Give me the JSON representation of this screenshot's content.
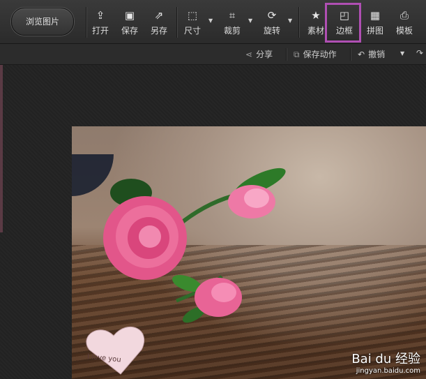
{
  "toolbar": {
    "browse_label": "浏览图片",
    "tools": [
      {
        "label": "打开",
        "icon": "open-icon",
        "glyph": "⇪"
      },
      {
        "label": "保存",
        "icon": "save-icon",
        "glyph": "▣"
      },
      {
        "label": "另存",
        "icon": "save-as-icon",
        "glyph": "⇗"
      },
      {
        "label": "尺寸",
        "icon": "resize-icon",
        "glyph": "⬚"
      },
      {
        "label": "裁剪",
        "icon": "crop-icon",
        "glyph": "⌗"
      },
      {
        "label": "旋转",
        "icon": "rotate-icon",
        "glyph": "⟳"
      },
      {
        "label": "素材",
        "icon": "sticker-icon",
        "glyph": "★"
      },
      {
        "label": "边框",
        "icon": "border-icon",
        "glyph": "◰"
      },
      {
        "label": "拼图",
        "icon": "collage-icon",
        "glyph": "▦"
      },
      {
        "label": "模板",
        "icon": "template-icon",
        "glyph": "⎙"
      }
    ]
  },
  "subbar": {
    "share_label": "分享",
    "save_action_label": "保存动作",
    "undo_label": "撤销"
  },
  "photo": {
    "heart_text": "I love you",
    "watermark_brand": "Bai du 经验",
    "watermark_url": "jingyan.baidu.com"
  },
  "colors": {
    "highlight": "#b04fb3",
    "rose": "#e2568a",
    "leaf": "#2f6b2a"
  }
}
